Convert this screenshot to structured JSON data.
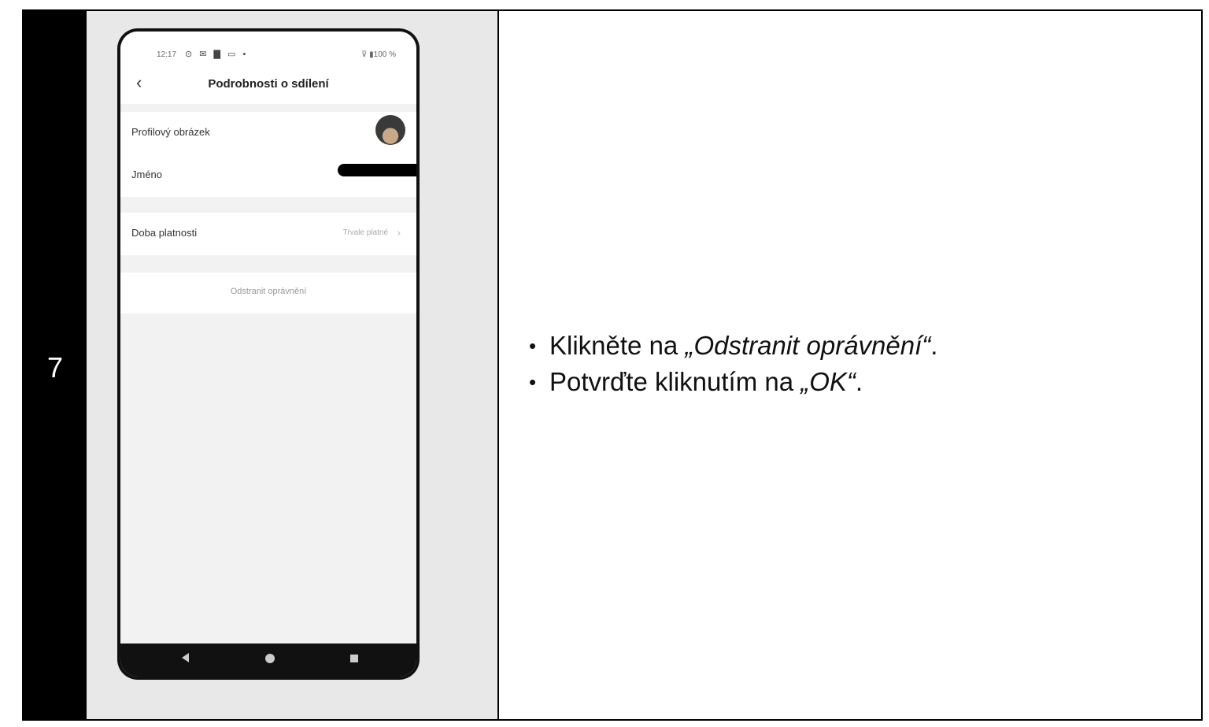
{
  "step": {
    "number": "7"
  },
  "phone": {
    "status": {
      "time": "12:17",
      "icons": "⊙ ✉ ▇ ▭ •",
      "battery": "⊽ ▮100 %"
    },
    "header": {
      "title": "Podrobnosti o sdílení"
    },
    "rows": {
      "profile_label": "Profilový obrázek",
      "name_label": "Jméno",
      "validity_label": "Doba platnosti",
      "validity_value": "Trvale platné"
    },
    "remove_label": "Odstranit oprávnění"
  },
  "instructions": {
    "line1_prefix": "Klikněte na ",
    "line1_emph": "„Odstranit oprávnění“",
    "line1_suffix": ".",
    "line2_prefix": "Potvrďte kliknutím na ",
    "line2_emph": "„OK“",
    "line2_suffix": "."
  }
}
